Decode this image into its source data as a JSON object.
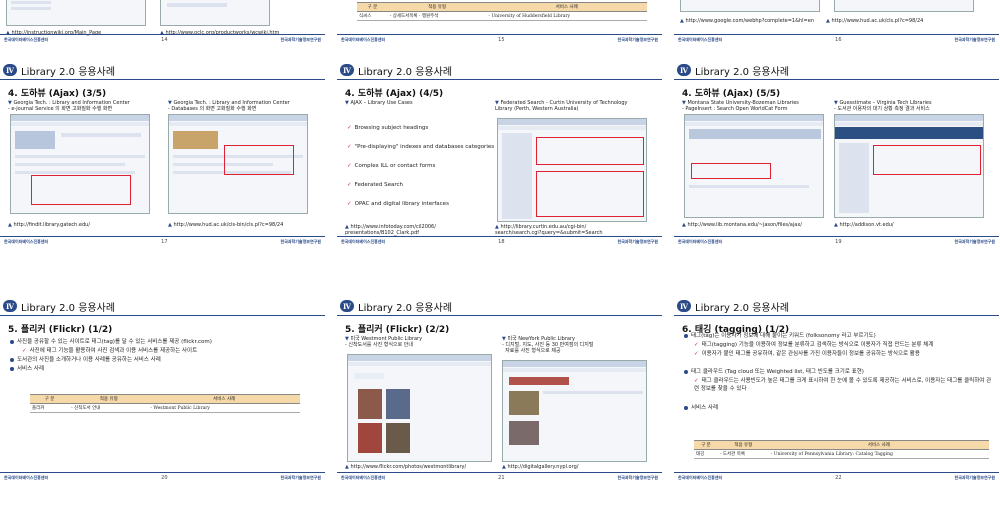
{
  "header_text": "Library 2.0 응용사례",
  "org_left": "한국데이터베이스진흥센터",
  "org_left_en": "Korea Database Promotion Center",
  "org_right": "한국과학기술정보연구원",
  "top_row": {
    "left_link": "http://instructionwiki.org/Main_Page",
    "left_link2": "http://www.oclc.org/productworks/wcwiki.htm",
    "left_page": "14",
    "mid_table": {
      "headers": [
        "구 분",
        "적용 유형",
        "서비스 사례"
      ],
      "row": [
        "식씨스",
        "- 상세도서목록 · 행원주석",
        "- University of Huddersfield Library"
      ]
    },
    "mid_page": "15",
    "right_link": "http://www.google.com/webhp?complete=1&hl=en",
    "right_link2": "http://www.hud.ac.uk/cls.pl?c=98/24",
    "right_page": "16"
  },
  "slides": [
    {
      "title": "4. 도하뷰 (Ajax) (3/5)",
      "cap1": "Georgia Tech. : Library and Information Center\n- e-journal Service 의 화면 고화질화 수행 화면",
      "cap2": "Georgia Tech. : Library and Information Center\n- Databases 의 화면 고화질화 수행 화면",
      "link1": "http://findit.library.gatech.edu/",
      "link2": "http://www.hud.ac.uk/cls-bin/cls.pl?c=98/24",
      "page": "17"
    },
    {
      "title": "4. 도하뷰 (Ajax) (4/5)",
      "cap1": "AJAX – Library Use Cases",
      "cap2": "Federated Search - Curtin University of Technology\nLibrary (Perth, Western Australia)",
      "items": [
        "Browsing subject headings",
        "\"Pre-displaying\" indexes and databases categories",
        "Complex ILL or contact forms",
        "Federated Search",
        "OPAC and digital library interfaces"
      ],
      "link1": "http://www.infotoday.com/cil2006/\npresentations/B102_Clark.pdf",
      "link2": "http://library.curtin.edu.au/cgi-bin/\nsearch/search.cgi?query=&submit=Search",
      "page": "18"
    },
    {
      "title": "4. 도하뷰 (Ajax) (5/5)",
      "cap1": "Montana State University-Bozeman Libraries\n- PageInsert : Search Open WorldCat Form",
      "cap2": "Guesstimate – Virginia Tech Libraries\n- 도서관 이용자의 대기 상황 측정 결과 서비스",
      "link1": "http://www.lib.montana.edu/~jason/files/ajax/",
      "link2": "http://addison.vt.edu/",
      "page": "19"
    },
    {
      "title": "5. 플리커 (Flickr) (1/2)",
      "b1": "사진을 공유할 수 있는 사이트로 태그(tag)를 달 수 있는 서비스를 제공 (flickr.com)",
      "b1sub": "사진에 태그 기능을 활용하여 사진 검색과 이용 서비스를 제공하는 사이트",
      "b2": "도서관의 사진을 소개하거나 이용 사례를 공유하는 서비스 사례",
      "b3": "서비스 사례",
      "table": {
        "headers": [
          "구 분",
          "적용 유형",
          "서비스 사례"
        ],
        "row": [
          "플리커",
          "- 신착도서 안내",
          "- Westmont Public Library"
        ]
      },
      "page": "20"
    },
    {
      "title": "5. 플리커 (Flickr) (2/2)",
      "cap1": "미국 Westmont Public Library\n- 신착도서를 사진 형식으로 안내",
      "cap2": "미국 NewYork Public Library\n- 디지털, 지도, 사진 등 30 만여점의 디지털\n  자료를 사진 형식으로 제공",
      "link1": "http://www.flickr.com/photos/westmontlibrary/",
      "link2": "http://digitalgallery.nypl.org/",
      "page": "21"
    },
    {
      "title": "6. 태깅 (tagging) (1/2)",
      "b1": "태그(tag)는 이용자가 정보에 대해 붙이는 키워드 (folksonomy 라고 부르기도)",
      "b1sub": "태그(tagging) 기능을 이용하여 정보를 분류하고 검색하는 방식으로 이용자가 직접 만드는 분류 체계",
      "b1sub2": "이용자가 붙인 태그를 공유하여, 같은 관심사를 가진 이용자들이 정보를 공유하는 방식으로 활용",
      "b2": "태그 클라우드 (Tag cloud 또는 Weighted list, 태그 빈도를 크기로 표현)",
      "b2sub": "태그 클라우드는 사용빈도가 높은 태그를 크게 표시하여 한 눈에 볼 수 있도록 제공하는 서비스로, 이용자는 태그를 클릭하여 관련 정보를 찾을 수 있다",
      "b3": "서비스 사례",
      "table": {
        "headers": [
          "구 분",
          "적용 유형",
          "서비스 사례"
        ],
        "row": [
          "태깅",
          "- 도서관 목록",
          "- University of Pennsylvania Library: Catalog Tagging"
        ]
      },
      "page": "22"
    }
  ]
}
